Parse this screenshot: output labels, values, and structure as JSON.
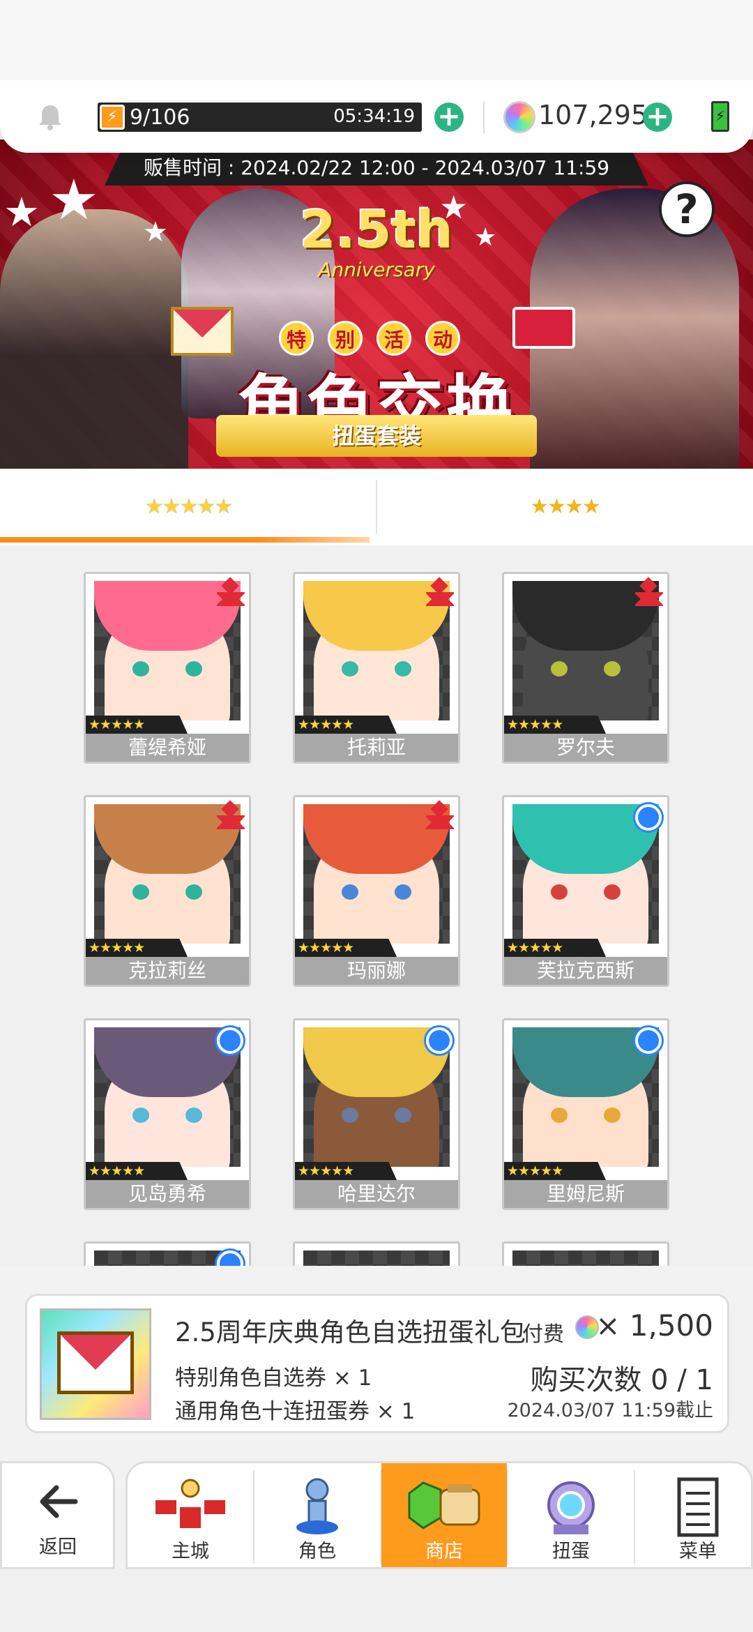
{
  "status": {
    "energy": "9/106",
    "timer": "05:34:19",
    "gems": "107,295",
    "plus_label": "+"
  },
  "banner": {
    "sale_time": "贩售时间 : 2024.02/22 12:00 - 2024.03/07 11:59",
    "anniv_number": "2.5th",
    "anniv_word": "Anniversary",
    "tokens": [
      "特",
      "别",
      "活",
      "动"
    ],
    "title": "角色交换",
    "subtitle": "扭蛋套装",
    "help_label": "?"
  },
  "tabs": [
    {
      "label": "★★★★★",
      "active": true
    },
    {
      "label": "★★★★",
      "active": false
    }
  ],
  "characters": [
    {
      "name": "蕾缇希娅",
      "stars": "★★★★★",
      "badge": "red",
      "hair": "#ff6b8f",
      "eye": "#2fb39e",
      "skin": "#ffe4d6"
    },
    {
      "name": "托莉亚",
      "stars": "★★★★★",
      "badge": "red",
      "hair": "#f7c84a",
      "eye": "#35b9a8",
      "skin": "#ffe6d6"
    },
    {
      "name": "罗尔夫",
      "stars": "★★★★★",
      "badge": "red",
      "hair": "#2a2a2a",
      "eye": "#b7c23a",
      "skin": "#4a4a4a"
    },
    {
      "name": "克拉莉丝",
      "stars": "★★★★★",
      "badge": "red",
      "hair": "#c7804a",
      "eye": "#2fb39e",
      "skin": "#ffe2cf"
    },
    {
      "name": "玛丽娜",
      "stars": "★★★★★",
      "badge": "red",
      "hair": "#e85a3c",
      "eye": "#4a86d8",
      "skin": "#ffe2cf"
    },
    {
      "name": "芙拉克西斯",
      "stars": "★★★★★",
      "badge": "blue",
      "hair": "#2fc1b0",
      "eye": "#d8403c",
      "skin": "#ffe6dc"
    },
    {
      "name": "见岛勇希",
      "stars": "★★★★★",
      "badge": "blue",
      "hair": "#6a5a7a",
      "eye": "#59b7d8",
      "skin": "#ffe6dc"
    },
    {
      "name": "哈里达尔",
      "stars": "★★★★★",
      "badge": "blue",
      "hair": "#f0c84a",
      "eye": "#6a7aa0",
      "skin": "#8a5a3a"
    },
    {
      "name": "里姆尼斯",
      "stars": "★★★★★",
      "badge": "blue",
      "hair": "#3a8a8a",
      "eye": "#e8a83a",
      "skin": "#ffe0cc"
    }
  ],
  "pack": {
    "title": "2.5周年庆典角色自选扭蛋礼包",
    "pay_label": "付费",
    "price": "× 1,500",
    "item1": "特别角色自选券 × 1",
    "item2": "通用角色十连扭蛋券 × 1",
    "buy_count": "购买次数 0 / 1",
    "deadline": "2024.03/07 11:59截止"
  },
  "nav": {
    "back": "返回",
    "items": [
      {
        "label": "主城",
        "active": false
      },
      {
        "label": "角色",
        "active": false
      },
      {
        "label": "商店",
        "active": true
      },
      {
        "label": "扭蛋",
        "active": false
      },
      {
        "label": "菜单",
        "active": false
      }
    ]
  },
  "colors": {
    "accent": "#ff9b1c",
    "plus": "#2bb581",
    "banner_red": "#c8152a"
  }
}
